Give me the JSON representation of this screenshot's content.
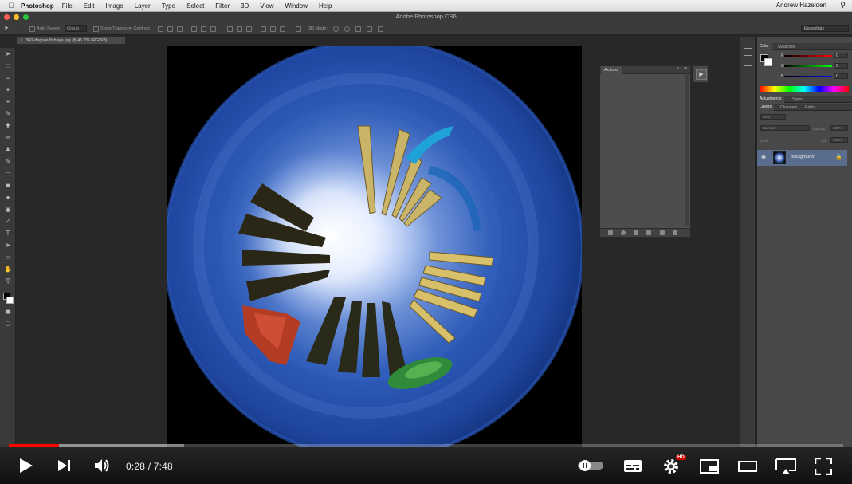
{
  "menubar": {
    "app_name": "Photoshop",
    "items": [
      "File",
      "Edit",
      "Image",
      "Layer",
      "Type",
      "Select",
      "Filter",
      "3D",
      "View",
      "Window",
      "Help"
    ],
    "user": "Andrew Hazelden"
  },
  "window": {
    "title": "Adobe Photoshop CS6"
  },
  "options_bar": {
    "auto_select_label": "Auto-Select:",
    "auto_select_value": "Group",
    "transform_label": "Show Transform Controls",
    "mode_3d_label": "3D Mode:",
    "workspace": "Essentials"
  },
  "document": {
    "tab_label": "360-degree-fisheye.jpg @ 45.7% (RGB/8)"
  },
  "actions_panel": {
    "tab": "Actions"
  },
  "right_panels": {
    "color_tabs": [
      "Color",
      "Swatches"
    ],
    "adjust_tabs": [
      "Adjustments",
      "Styles"
    ],
    "layers_tabs": [
      "Layers",
      "Channels",
      "Paths"
    ],
    "kind_filter": "Kind",
    "blend_mode": "Normal",
    "opacity_label": "Opacity:",
    "opacity_value": "100%",
    "fill_label": "Fill:",
    "fill_value": "100%",
    "lock_label": "Lock:",
    "rgb": [
      {
        "label": "R",
        "value": "0"
      },
      {
        "label": "G",
        "value": "0"
      },
      {
        "label": "B",
        "value": "0"
      }
    ],
    "layer_name": "Background"
  },
  "player": {
    "current_time": "0:28",
    "duration": "7:48",
    "time_display": "0:28 / 7:48",
    "played_fraction": 0.06,
    "buffered_fraction": 0.21,
    "quality_badge": "HD"
  },
  "colors": {
    "progress_played": "#ff0000",
    "photoshop_panel": "#484848",
    "layer_selected": "#5a6d8c"
  }
}
